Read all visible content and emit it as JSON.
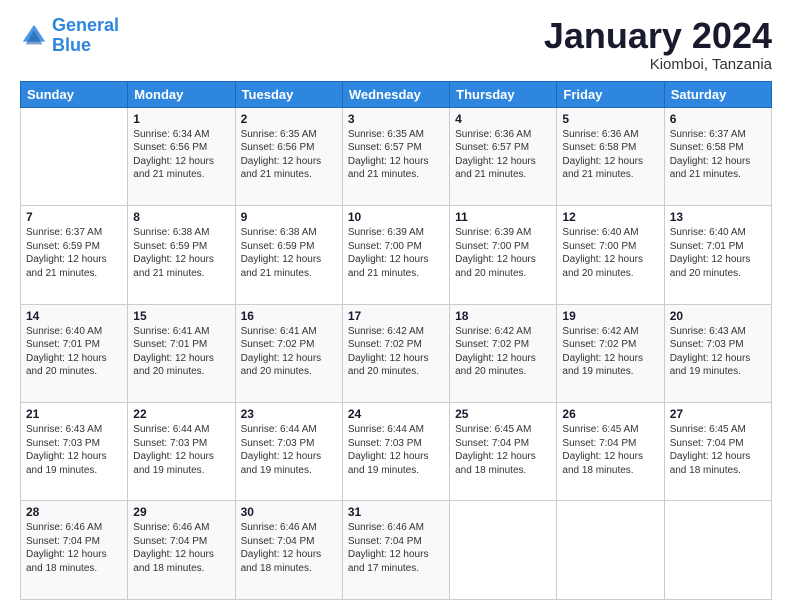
{
  "logo": {
    "line1": "General",
    "line2": "Blue"
  },
  "header": {
    "month_title": "January 2024",
    "subtitle": "Kiomboi, Tanzania"
  },
  "days_of_week": [
    "Sunday",
    "Monday",
    "Tuesday",
    "Wednesday",
    "Thursday",
    "Friday",
    "Saturday"
  ],
  "weeks": [
    [
      {
        "day": "",
        "sunrise": "",
        "sunset": "",
        "daylight": ""
      },
      {
        "day": "1",
        "sunrise": "Sunrise: 6:34 AM",
        "sunset": "Sunset: 6:56 PM",
        "daylight": "Daylight: 12 hours and 21 minutes."
      },
      {
        "day": "2",
        "sunrise": "Sunrise: 6:35 AM",
        "sunset": "Sunset: 6:56 PM",
        "daylight": "Daylight: 12 hours and 21 minutes."
      },
      {
        "day": "3",
        "sunrise": "Sunrise: 6:35 AM",
        "sunset": "Sunset: 6:57 PM",
        "daylight": "Daylight: 12 hours and 21 minutes."
      },
      {
        "day": "4",
        "sunrise": "Sunrise: 6:36 AM",
        "sunset": "Sunset: 6:57 PM",
        "daylight": "Daylight: 12 hours and 21 minutes."
      },
      {
        "day": "5",
        "sunrise": "Sunrise: 6:36 AM",
        "sunset": "Sunset: 6:58 PM",
        "daylight": "Daylight: 12 hours and 21 minutes."
      },
      {
        "day": "6",
        "sunrise": "Sunrise: 6:37 AM",
        "sunset": "Sunset: 6:58 PM",
        "daylight": "Daylight: 12 hours and 21 minutes."
      }
    ],
    [
      {
        "day": "7",
        "sunrise": "Sunrise: 6:37 AM",
        "sunset": "Sunset: 6:59 PM",
        "daylight": "Daylight: 12 hours and 21 minutes."
      },
      {
        "day": "8",
        "sunrise": "Sunrise: 6:38 AM",
        "sunset": "Sunset: 6:59 PM",
        "daylight": "Daylight: 12 hours and 21 minutes."
      },
      {
        "day": "9",
        "sunrise": "Sunrise: 6:38 AM",
        "sunset": "Sunset: 6:59 PM",
        "daylight": "Daylight: 12 hours and 21 minutes."
      },
      {
        "day": "10",
        "sunrise": "Sunrise: 6:39 AM",
        "sunset": "Sunset: 7:00 PM",
        "daylight": "Daylight: 12 hours and 21 minutes."
      },
      {
        "day": "11",
        "sunrise": "Sunrise: 6:39 AM",
        "sunset": "Sunset: 7:00 PM",
        "daylight": "Daylight: 12 hours and 20 minutes."
      },
      {
        "day": "12",
        "sunrise": "Sunrise: 6:40 AM",
        "sunset": "Sunset: 7:00 PM",
        "daylight": "Daylight: 12 hours and 20 minutes."
      },
      {
        "day": "13",
        "sunrise": "Sunrise: 6:40 AM",
        "sunset": "Sunset: 7:01 PM",
        "daylight": "Daylight: 12 hours and 20 minutes."
      }
    ],
    [
      {
        "day": "14",
        "sunrise": "Sunrise: 6:40 AM",
        "sunset": "Sunset: 7:01 PM",
        "daylight": "Daylight: 12 hours and 20 minutes."
      },
      {
        "day": "15",
        "sunrise": "Sunrise: 6:41 AM",
        "sunset": "Sunset: 7:01 PM",
        "daylight": "Daylight: 12 hours and 20 minutes."
      },
      {
        "day": "16",
        "sunrise": "Sunrise: 6:41 AM",
        "sunset": "Sunset: 7:02 PM",
        "daylight": "Daylight: 12 hours and 20 minutes."
      },
      {
        "day": "17",
        "sunrise": "Sunrise: 6:42 AM",
        "sunset": "Sunset: 7:02 PM",
        "daylight": "Daylight: 12 hours and 20 minutes."
      },
      {
        "day": "18",
        "sunrise": "Sunrise: 6:42 AM",
        "sunset": "Sunset: 7:02 PM",
        "daylight": "Daylight: 12 hours and 20 minutes."
      },
      {
        "day": "19",
        "sunrise": "Sunrise: 6:42 AM",
        "sunset": "Sunset: 7:02 PM",
        "daylight": "Daylight: 12 hours and 19 minutes."
      },
      {
        "day": "20",
        "sunrise": "Sunrise: 6:43 AM",
        "sunset": "Sunset: 7:03 PM",
        "daylight": "Daylight: 12 hours and 19 minutes."
      }
    ],
    [
      {
        "day": "21",
        "sunrise": "Sunrise: 6:43 AM",
        "sunset": "Sunset: 7:03 PM",
        "daylight": "Daylight: 12 hours and 19 minutes."
      },
      {
        "day": "22",
        "sunrise": "Sunrise: 6:44 AM",
        "sunset": "Sunset: 7:03 PM",
        "daylight": "Daylight: 12 hours and 19 minutes."
      },
      {
        "day": "23",
        "sunrise": "Sunrise: 6:44 AM",
        "sunset": "Sunset: 7:03 PM",
        "daylight": "Daylight: 12 hours and 19 minutes."
      },
      {
        "day": "24",
        "sunrise": "Sunrise: 6:44 AM",
        "sunset": "Sunset: 7:03 PM",
        "daylight": "Daylight: 12 hours and 19 minutes."
      },
      {
        "day": "25",
        "sunrise": "Sunrise: 6:45 AM",
        "sunset": "Sunset: 7:04 PM",
        "daylight": "Daylight: 12 hours and 18 minutes."
      },
      {
        "day": "26",
        "sunrise": "Sunrise: 6:45 AM",
        "sunset": "Sunset: 7:04 PM",
        "daylight": "Daylight: 12 hours and 18 minutes."
      },
      {
        "day": "27",
        "sunrise": "Sunrise: 6:45 AM",
        "sunset": "Sunset: 7:04 PM",
        "daylight": "Daylight: 12 hours and 18 minutes."
      }
    ],
    [
      {
        "day": "28",
        "sunrise": "Sunrise: 6:46 AM",
        "sunset": "Sunset: 7:04 PM",
        "daylight": "Daylight: 12 hours and 18 minutes."
      },
      {
        "day": "29",
        "sunrise": "Sunrise: 6:46 AM",
        "sunset": "Sunset: 7:04 PM",
        "daylight": "Daylight: 12 hours and 18 minutes."
      },
      {
        "day": "30",
        "sunrise": "Sunrise: 6:46 AM",
        "sunset": "Sunset: 7:04 PM",
        "daylight": "Daylight: 12 hours and 18 minutes."
      },
      {
        "day": "31",
        "sunrise": "Sunrise: 6:46 AM",
        "sunset": "Sunset: 7:04 PM",
        "daylight": "Daylight: 12 hours and 17 minutes."
      },
      {
        "day": "",
        "sunrise": "",
        "sunset": "",
        "daylight": ""
      },
      {
        "day": "",
        "sunrise": "",
        "sunset": "",
        "daylight": ""
      },
      {
        "day": "",
        "sunrise": "",
        "sunset": "",
        "daylight": ""
      }
    ]
  ]
}
